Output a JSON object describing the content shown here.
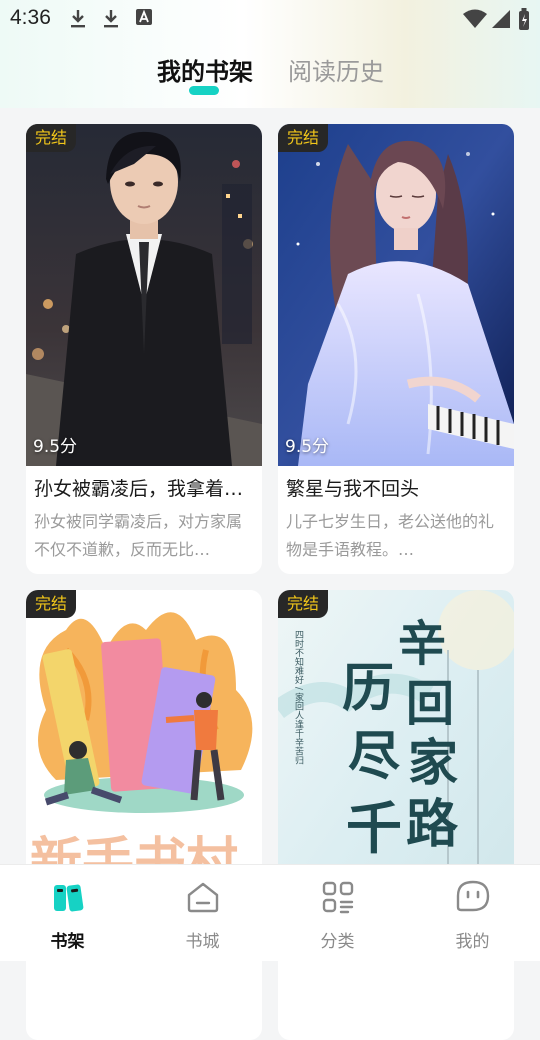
{
  "status_bar": {
    "time": "4:36"
  },
  "tabs": [
    {
      "label": "我的书架",
      "active": true
    },
    {
      "label": "阅读历史",
      "active": false
    }
  ],
  "books": [
    {
      "badge": "完结",
      "score": "9.5分",
      "title": "孙女被霸凌后，我拿着…",
      "desc": "孙女被同学霸凌后，对方家属不仅不道歉，反而无比…",
      "cover": "man-in-suit-cover"
    },
    {
      "badge": "完结",
      "score": "9.5分",
      "title": "繁星与我不回头",
      "desc": "儿子七岁生日，老公送他的礼物是手语教程。…",
      "cover": "girl-at-piano-cover"
    },
    {
      "badge": "完结",
      "score": "",
      "title": "",
      "desc": "",
      "cover": "books-illustration-cover",
      "cover_text": "新手书村"
    },
    {
      "badge": "完结",
      "score": "",
      "title": "",
      "desc": "",
      "cover": "calligraphy-cover",
      "cover_text": [
        "历",
        "尽",
        "千",
        "辛",
        "回",
        "家",
        "路"
      ],
      "cover_side_text": "四时不知难好 / 家回人逢千辛苦归"
    }
  ],
  "bottom_nav": [
    {
      "label": "书架",
      "icon": "bookshelf-icon",
      "active": true
    },
    {
      "label": "书城",
      "icon": "bookstore-icon",
      "active": false
    },
    {
      "label": "分类",
      "icon": "category-icon",
      "active": false
    },
    {
      "label": "我的",
      "icon": "profile-icon",
      "active": false
    }
  ],
  "colors": {
    "accent": "#16d2c4",
    "badge_bg": "#272727",
    "badge_text": "#f1c61a"
  }
}
